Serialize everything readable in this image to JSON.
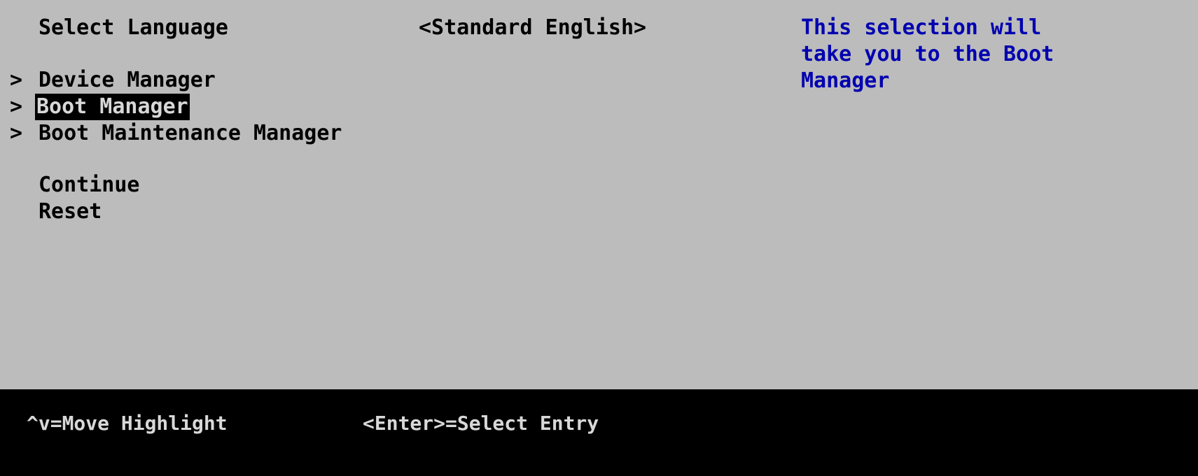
{
  "screen": {
    "background_color": "#bcbcbc",
    "statusbar_background_color": "#000000",
    "text_color": "#000000",
    "help_text_color": "#0000b0",
    "highlight_background_color": "#000000",
    "highlight_text_color": "#d8d8d8",
    "statusbar_text_color": "#d8d8d8"
  },
  "form": {
    "language_row": {
      "label": "Select Language",
      "value": "<Standard English>"
    },
    "menu_items": [
      {
        "marker": ">",
        "label": "Device Manager",
        "selected": false,
        "submenu": true
      },
      {
        "marker": ">",
        "label": "Boot Manager",
        "selected": true,
        "submenu": true
      },
      {
        "marker": ">",
        "label": "Boot Maintenance Manager",
        "selected": false,
        "submenu": true
      }
    ],
    "action_items": [
      {
        "label": "Continue",
        "selected": false
      },
      {
        "label": "Reset",
        "selected": false
      }
    ]
  },
  "help": {
    "lines": [
      "This selection will",
      "take you to the Boot",
      "Manager"
    ]
  },
  "statusbar": {
    "hotkeys": [
      {
        "label": "^v=Move Highlight"
      },
      {
        "label": "<Enter>=Select Entry"
      }
    ]
  }
}
